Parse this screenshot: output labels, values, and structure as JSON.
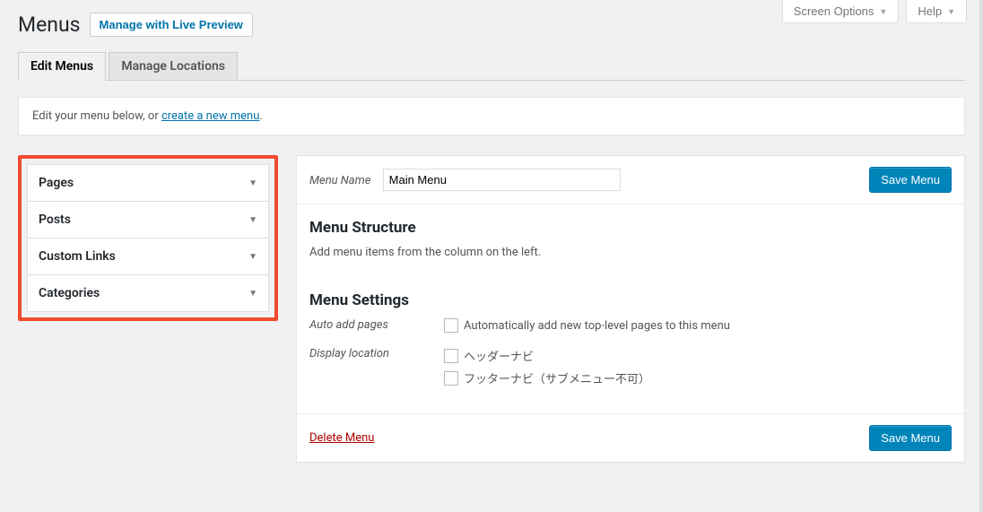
{
  "top": {
    "screen_options": "Screen Options",
    "help": "Help"
  },
  "header": {
    "title": "Menus",
    "live_preview": "Manage with Live Preview"
  },
  "tabs": {
    "edit": "Edit Menus",
    "locations": "Manage Locations"
  },
  "manage_box": {
    "prefix": "Edit your menu below, or ",
    "link": "create a new menu",
    "suffix": "."
  },
  "sidebar": {
    "items": [
      {
        "label": "Pages"
      },
      {
        "label": "Posts"
      },
      {
        "label": "Custom Links"
      },
      {
        "label": "Categories"
      }
    ]
  },
  "menu_edit": {
    "name_label": "Menu Name",
    "name_value": "Main Menu",
    "save": "Save Menu",
    "structure_heading": "Menu Structure",
    "structure_hint": "Add menu items from the column on the left.",
    "settings_heading": "Menu Settings",
    "auto_add_label": "Auto add pages",
    "auto_add_option": "Automatically add new top-level pages to this menu",
    "display_location_label": "Display location",
    "location1": "ヘッダーナビ",
    "location2": "フッターナビ（サブメニュー不可）",
    "delete": "Delete Menu"
  }
}
